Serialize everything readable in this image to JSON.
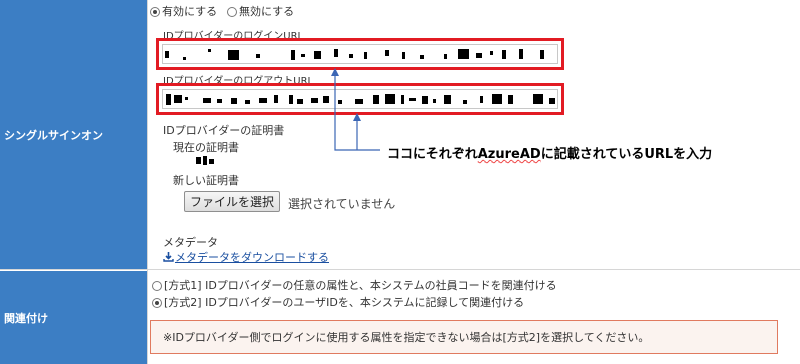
{
  "sections": {
    "sso_label": "シングルサインオン",
    "mapping_label": "関連付け"
  },
  "sso": {
    "enable_label": "有効にする",
    "disable_label": "無効にする",
    "login_url_label": "IDプロバイダーのログインURL",
    "logout_url_label": "IDプロバイダーのログアウトURL",
    "cert_label": "IDプロバイダーの証明書",
    "current_cert_label": "現在の証明書",
    "new_cert_label": "新しい証明書",
    "file_button": "ファイルを選択",
    "file_status": "選択されていません",
    "metadata_label": "メタデータ",
    "metadata_link": "メタデータをダウンロードする"
  },
  "annotation": {
    "prefix": "ココにそれぞれ",
    "word": "AzureAD",
    "suffix": "に記載されているURLを入力"
  },
  "mapping": {
    "option1": "[方式1] IDプロバイダーの任意の属性と、本システムの社員コードを関連付ける",
    "option2": "[方式2] IDプロバイダーのユーザIDを、本システムに記録して関連付ける",
    "selected": "option2",
    "notice": "※IDプロバイダー側でログインに使用する属性を指定できない場合は[方式2]を選択してください。"
  },
  "colors": {
    "sidebar": "#3c7ec4",
    "highlight_border": "#e21b23",
    "arrow": "#3b66b5",
    "link": "#1a4fa0"
  }
}
